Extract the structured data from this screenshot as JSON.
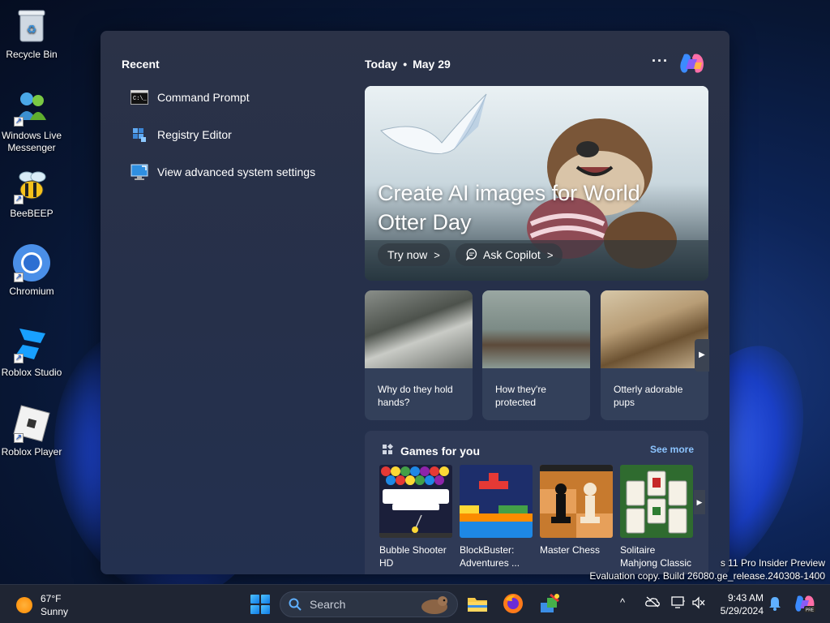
{
  "desktop": {
    "icons": [
      {
        "label": "Recycle Bin",
        "icon": "recycle-bin-icon"
      },
      {
        "label": "Windows Live Messenger",
        "icon": "messenger-icon"
      },
      {
        "label": "BeeBEEP",
        "icon": "bee-icon"
      },
      {
        "label": "Chromium",
        "icon": "chromium-icon"
      },
      {
        "label": "Roblox Studio",
        "icon": "roblox-studio-icon"
      },
      {
        "label": "Roblox Player",
        "icon": "roblox-player-icon"
      }
    ],
    "watermark_line1": "s 11 Pro Insider Preview",
    "watermark_line2": "Evaluation copy. Build 26080.ge_release.240308-1400"
  },
  "widgets": {
    "recent_title": "Recent",
    "recent_items": [
      {
        "label": "Command Prompt",
        "icon": "command-prompt-icon"
      },
      {
        "label": "Registry Editor",
        "icon": "registry-editor-icon"
      },
      {
        "label": "View advanced system settings",
        "icon": "system-settings-icon"
      }
    ],
    "today_label": "Today",
    "date_label": "May 29",
    "more_label": "···",
    "hero": {
      "title": "Create AI images for World Otter Day",
      "try_now": "Try now",
      "ask_copilot": "Ask Copilot"
    },
    "cards": [
      {
        "caption": "Why do they hold hands?"
      },
      {
        "caption": "How they're protected"
      },
      {
        "caption": "Otterly adorable pups"
      }
    ],
    "games": {
      "title": "Games for you",
      "see_more": "See more",
      "items": [
        {
          "name": "Bubble Shooter HD"
        },
        {
          "name": "BlockBuster: Adventures ..."
        },
        {
          "name": "Master Chess"
        },
        {
          "name": "Solitaire Mahjong Classic"
        }
      ]
    }
  },
  "taskbar": {
    "weather_temp": "67°F",
    "weather_cond": "Sunny",
    "search_placeholder": "Search",
    "time": "9:43 AM",
    "date": "5/29/2024"
  },
  "colors": {
    "accent": "#8cc4ff",
    "panel": "#2b3247",
    "taskbar": "#1f2533"
  }
}
